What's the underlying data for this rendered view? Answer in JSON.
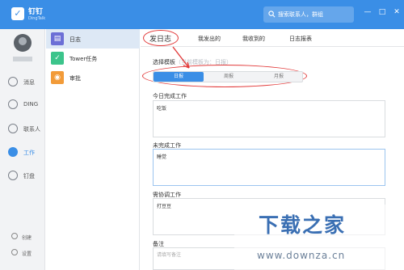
{
  "app": {
    "name": "钉钉",
    "name_en": "DingTalk",
    "accent": "#3a8ee6"
  },
  "search": {
    "placeholder": "搜索联系人，群组"
  },
  "rail": {
    "items": [
      {
        "label": "消息"
      },
      {
        "label": "DING"
      },
      {
        "label": "联系人"
      },
      {
        "label": "工作"
      },
      {
        "label": "钉盘"
      }
    ],
    "active_index": 3,
    "bottom": [
      {
        "label": "创建"
      },
      {
        "label": "设置"
      }
    ]
  },
  "apps": {
    "items": [
      {
        "label": "日志",
        "icon": "log-icon"
      },
      {
        "label": "Tower任务",
        "icon": "check-icon"
      },
      {
        "label": "审批",
        "icon": "approval-icon"
      }
    ],
    "active_index": 0
  },
  "tabs": [
    {
      "label": "发日志"
    },
    {
      "label": "我发出的"
    },
    {
      "label": "我收到的"
    },
    {
      "label": "日志报表"
    }
  ],
  "form": {
    "template_label": "选择模板",
    "template_hint": "（当前模板为：日报）",
    "template_options": [
      "日报",
      "周报",
      "月报"
    ],
    "template_selected": "日报",
    "fields": [
      {
        "label": "今日完成工作",
        "value": "吃饭"
      },
      {
        "label": "未完成工作",
        "value": "睡觉"
      },
      {
        "label": "需协调工作",
        "value": "打豆豆"
      },
      {
        "label": "备注",
        "placeholder": "请填写备注"
      }
    ]
  },
  "watermark": {
    "title": "下载之家",
    "url": "www.downza.cn"
  },
  "annotation_color": "#e23b3b"
}
